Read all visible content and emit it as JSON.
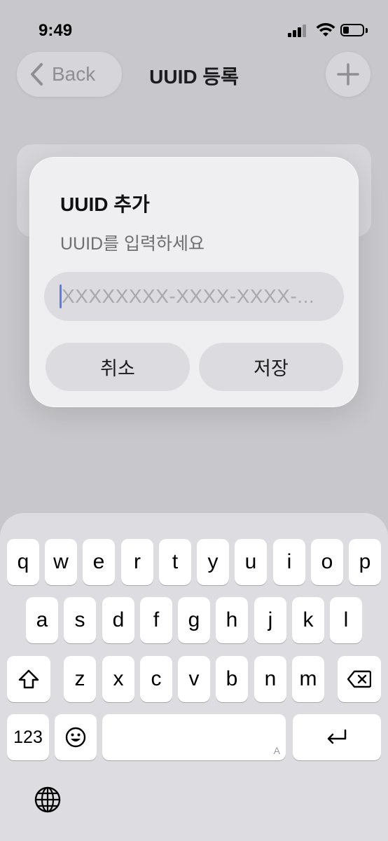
{
  "status_bar": {
    "time": "9:49"
  },
  "nav": {
    "back_label": "Back",
    "title": "UUID 등록"
  },
  "dialog": {
    "title": "UUID 추가",
    "message": "UUID를 입력하세요",
    "input_placeholder": "XXXXXXXX-XXXX-XXXX-...",
    "input_value": "",
    "cancel_label": "취소",
    "save_label": "저장"
  },
  "keyboard": {
    "row1": [
      "q",
      "w",
      "e",
      "r",
      "t",
      "y",
      "u",
      "i",
      "o",
      "p"
    ],
    "row2": [
      "a",
      "s",
      "d",
      "f",
      "g",
      "h",
      "j",
      "k",
      "l"
    ],
    "row3": [
      "z",
      "x",
      "c",
      "v",
      "b",
      "n",
      "m"
    ],
    "numbers_label": "123",
    "space_hint": "A",
    "icons": [
      "shift-icon",
      "delete-icon",
      "emoji-icon",
      "return-icon",
      "globe-icon"
    ]
  },
  "colors": {
    "caret": "#5b7cf0",
    "dialog_bg": "#efeff2",
    "keyboard_bg": "#dcdce1"
  }
}
